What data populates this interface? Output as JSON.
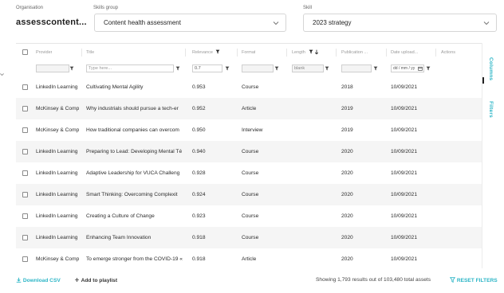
{
  "filters_bar": {
    "organisation_label": "Organisation",
    "organisation_value": "assesscontent...",
    "skills_group_label": "Skills group",
    "skills_group_value": "Content health assessment",
    "skill_label": "Skill",
    "skill_value": "2023 strategy"
  },
  "columns": [
    "Provider",
    "Title",
    "Relevance",
    "Format",
    "Length",
    "Publication ...",
    "Date upload...",
    "Actions"
  ],
  "column_filters": {
    "title_placeholder": "Type here...",
    "relevance": "0.7",
    "length": "blank",
    "date_placeholder": "dd / mm / yy"
  },
  "rows": [
    {
      "provider": "LinkedIn Learning",
      "title": "Cultivating Mental Agility",
      "relevance": "0.953",
      "format": "Course",
      "year": "2018",
      "date": "10/09/2021"
    },
    {
      "provider": "McKinsey & Comp",
      "title": "Why industrials should pursue a tech-er",
      "relevance": "0.952",
      "format": "Article",
      "year": "2019",
      "date": "10/09/2021"
    },
    {
      "provider": "McKinsey & Comp",
      "title": "How traditional companies can overcom",
      "relevance": "0.950",
      "format": "Interview",
      "year": "2019",
      "date": "10/09/2021"
    },
    {
      "provider": "LinkedIn Learning",
      "title": "Preparing to Lead: Developing Mental Té",
      "relevance": "0.940",
      "format": "Course",
      "year": "2020",
      "date": "10/09/2021"
    },
    {
      "provider": "LinkedIn Learning",
      "title": "Adaptive Leadership for VUCA Challeng",
      "relevance": "0.928",
      "format": "Course",
      "year": "2020",
      "date": "10/09/2021"
    },
    {
      "provider": "LinkedIn Learning",
      "title": "Smart Thinking: Overcoming Complexit",
      "relevance": "0.924",
      "format": "Course",
      "year": "2020",
      "date": "10/09/2021"
    },
    {
      "provider": "LinkedIn Learning",
      "title": "Creating a Culture of Change",
      "relevance": "0.923",
      "format": "Course",
      "year": "2020",
      "date": "10/09/2021"
    },
    {
      "provider": "LinkedIn Learning",
      "title": "Enhancing Team Innovation",
      "relevance": "0.918",
      "format": "Course",
      "year": "2020",
      "date": "10/09/2021"
    },
    {
      "provider": "McKinsey & Comp",
      "title": "To emerge stronger from the COVID-19 «",
      "relevance": "0.918",
      "format": "Article",
      "year": "2020",
      "date": "10/09/2021"
    }
  ],
  "side_tabs": {
    "columns": "Columns",
    "filters": "Filters"
  },
  "footer": {
    "download_csv": "Download CSV",
    "add_to_playlist": "Add to playlist",
    "results": "Showing 1,793 results out of 103,480 total assets",
    "reset_filters": "RESET FILTERS"
  },
  "colors": {
    "accent": "#2bb5c6",
    "row_alt": "#f5f5f5"
  },
  "icons": [
    "chevron-down-icon",
    "filter-icon",
    "sort-down-icon",
    "calendar-icon",
    "download-icon",
    "plus-icon",
    "checkbox"
  ]
}
